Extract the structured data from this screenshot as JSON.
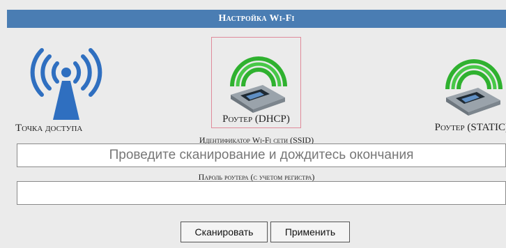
{
  "window": {
    "title": "Настройка Wi-Fi"
  },
  "modes": [
    {
      "id": "ap",
      "label": "Точка доступа",
      "icon": "access-point-icon",
      "selected": false
    },
    {
      "id": "dhcp",
      "label": "Роутер (DHCP)",
      "icon": "router-icon",
      "selected": true
    },
    {
      "id": "static",
      "label": "Роутер (STATIC)",
      "icon": "router-icon",
      "selected": false
    }
  ],
  "ssid": {
    "label": "Идентификатор Wi-Fi сети (SSID)",
    "placeholder": "Проведите сканирование и дождитесь окончания",
    "value": ""
  },
  "password": {
    "label": "Пароль роутера (с учетом регистра)",
    "value": ""
  },
  "buttons": {
    "scan": "Сканировать",
    "apply": "Применить"
  },
  "colors": {
    "titlebar": "#4a7db3",
    "antenna_blue": "#2f6fc0",
    "signal_green": "#2fb12f",
    "selection_border": "#e08a9a"
  }
}
